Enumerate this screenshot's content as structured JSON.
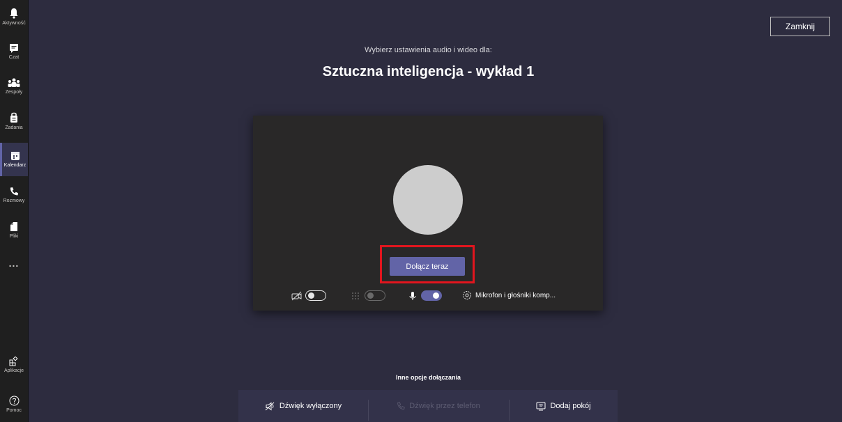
{
  "rail": {
    "items": [
      {
        "label": "Aktywność",
        "icon": "bell-icon"
      },
      {
        "label": "Czat",
        "icon": "chat-icon"
      },
      {
        "label": "Zespoły",
        "icon": "teams-icon"
      },
      {
        "label": "Zadania",
        "icon": "assignments-icon"
      },
      {
        "label": "Kalendarz",
        "icon": "calendar-icon",
        "active": true
      },
      {
        "label": "Rozmowy",
        "icon": "phone-icon"
      },
      {
        "label": "Pliki",
        "icon": "file-icon"
      }
    ],
    "more": "...",
    "apps_label": "Aplikacje",
    "help_label": "Pomoc"
  },
  "header": {
    "close_label": "Zamknij",
    "subtitle": "Wybierz ustawienia audio i wideo dla:",
    "meeting_title": "Sztuczna inteligencja - wykład 1"
  },
  "preview": {
    "join_label": "Dołącz teraz",
    "camera_on": false,
    "blur_on": false,
    "mic_on": true,
    "device_label": "Mikrofon i głośniki komp..."
  },
  "other_options": {
    "title": "Inne opcje dołączania",
    "audio_off_label": "Dźwięk wyłączony",
    "phone_audio_label": "Dźwięk przez telefon",
    "add_room_label": "Dodaj pokój"
  },
  "colors": {
    "accent": "#6264a7",
    "background": "#2d2c3f",
    "highlight": "#e2151e"
  }
}
